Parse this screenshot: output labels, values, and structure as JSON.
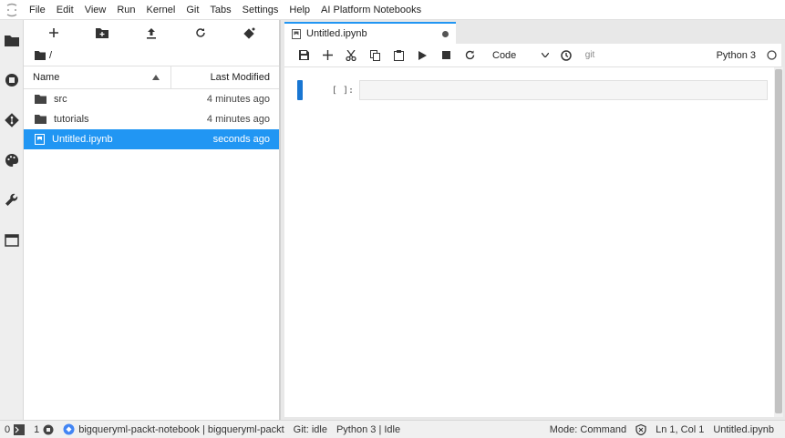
{
  "menubar": {
    "items": [
      "File",
      "Edit",
      "View",
      "Run",
      "Kernel",
      "Git",
      "Tabs",
      "Settings",
      "Help",
      "AI Platform Notebooks"
    ]
  },
  "activity_bar": {
    "icons": [
      "folder-icon",
      "running-icon",
      "git-icon",
      "palette-icon",
      "wrench-icon",
      "tabs-icon"
    ]
  },
  "filebrowser": {
    "toolbar": [
      "new-launcher-icon",
      "new-folder-icon",
      "upload-icon",
      "refresh-icon",
      "git-clone-icon"
    ],
    "breadcrumb": "/",
    "header": {
      "name": "Name",
      "modified": "Last Modified"
    },
    "rows": [
      {
        "name": "src",
        "modified": "4 minutes ago",
        "type": "folder"
      },
      {
        "name": "tutorials",
        "modified": "4 minutes ago",
        "type": "folder"
      },
      {
        "name": "Untitled.ipynb",
        "modified": "seconds ago",
        "type": "notebook",
        "selected": true
      }
    ]
  },
  "notebook": {
    "tab_label": "Untitled.ipynb",
    "cell_type": "Code",
    "kernel_name": "Python 3",
    "git_label": "git",
    "cell_prompt": "[ ]:"
  },
  "statusbar": {
    "terminals": "0",
    "kernels": "1",
    "env": "bigqueryml-packt-notebook | bigqueryml-packt",
    "git_status": "Git: idle",
    "kernel_status": "Python 3 | Idle",
    "mode": "Mode: Command",
    "position": "Ln 1, Col 1",
    "file": "Untitled.ipynb"
  },
  "colors": {
    "accent": "#2196f3",
    "collapser": "#1976d2"
  }
}
